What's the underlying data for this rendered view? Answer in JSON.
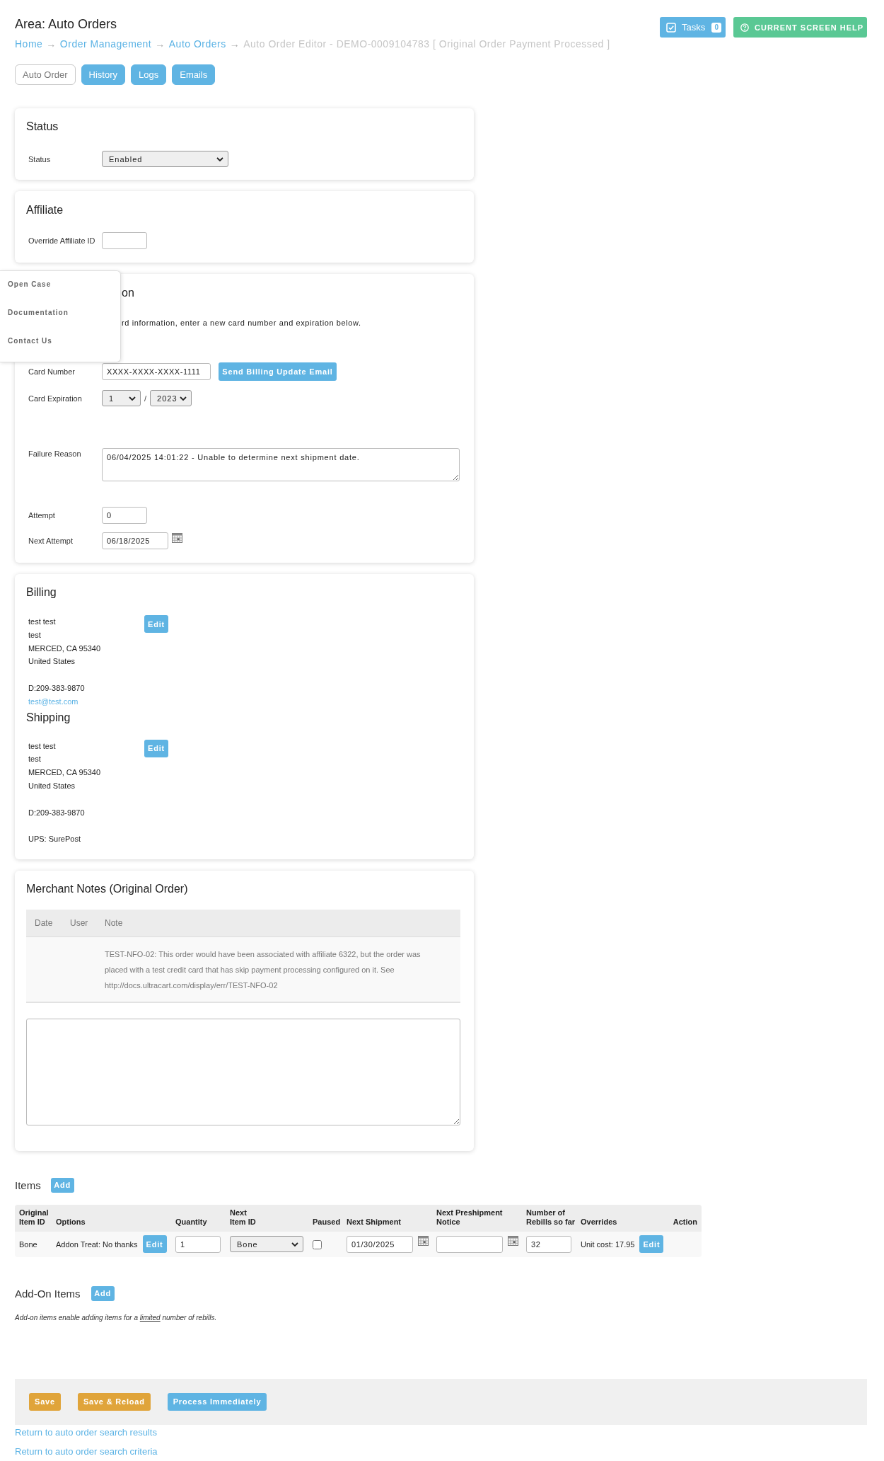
{
  "header": {
    "title": "Area: Auto Orders",
    "breadcrumb": [
      {
        "label": "Home",
        "current": false,
        "separator": "→"
      },
      {
        "label": "Order Management",
        "current": false,
        "separator": "→"
      },
      {
        "label": "Auto Orders",
        "current": false,
        "separator": "→"
      },
      {
        "label": "Auto Order Editor - DEMO-0009104783 [ Original Order Payment Processed ]",
        "current": true
      }
    ],
    "tasks": {
      "label": "Tasks",
      "count": "0"
    },
    "help_button": "CURRENT SCREEN HELP"
  },
  "tabs": [
    {
      "label": "Auto Order",
      "selected": true
    },
    {
      "label": "History",
      "selected": false
    },
    {
      "label": "Logs",
      "selected": false
    },
    {
      "label": "Emails",
      "selected": false
    }
  ],
  "help_menu": {
    "items": [
      "Open Case",
      "Documentation",
      "Contact Us"
    ]
  },
  "status": {
    "title": "Status",
    "label": "Status",
    "value": "Enabled"
  },
  "affiliate": {
    "title": "Affiliate",
    "label": "Override Affiliate ID"
  },
  "card_info": {
    "title": "on",
    "note": "rd information, enter a new card number and expiration below.",
    "card_number": {
      "label": "Card Number",
      "value": "XXXX-XXXX-XXXX-1111",
      "button": "Send Billing Update Email"
    },
    "expiration": {
      "label": "Card Expiration",
      "month": "1",
      "separator": "/",
      "year": "2023"
    },
    "failure_reason": {
      "label": "Failure Reason",
      "value": "06/04/2025 14:01:22 - Unable to determine next shipment date."
    },
    "attempt": {
      "label": "Attempt",
      "value": "0"
    },
    "next_attempt": {
      "label": "Next Attempt",
      "value": "06/18/2025"
    }
  },
  "billing": {
    "title": "Billing",
    "edit": "Edit",
    "address": [
      "test test",
      "test",
      "MERCED, CA 95340",
      "United States"
    ],
    "phone": "D:209-383-9870",
    "email": "test@test.com"
  },
  "shipping": {
    "title": "Shipping",
    "edit": "Edit",
    "address": [
      "test test",
      "test",
      "MERCED, CA 95340",
      "United States"
    ],
    "phone": "D:209-383-9870",
    "method": "UPS: SurePost"
  },
  "merchant_notes": {
    "title": "Merchant Notes (Original Order)",
    "columns": [
      "Date",
      "User",
      "Note"
    ],
    "rows": [
      {
        "note": "TEST-NFO-02: This order would have been associated with affiliate 6322, but the order was placed with a test credit card that has skip payment processing configured on it. See http://docs.ultracart.com/display/err/TEST-NFO-02"
      }
    ]
  },
  "items": {
    "title": "Items",
    "add": "Add",
    "columns": [
      "Original\nItem ID",
      "Options",
      "Quantity",
      "Next\nItem ID",
      "Paused",
      "Next Shipment",
      "Next Preshipment\nNotice",
      "Number of\nRebills so far",
      "Overrides",
      "Action"
    ],
    "rows": [
      {
        "original_item_id": "Bone",
        "options": "Addon Treat: No thanks",
        "options_edit": "Edit",
        "quantity": "1",
        "next_item_id": "Bone",
        "paused": false,
        "next_shipment": "01/30/2025",
        "rebills": "32",
        "overrides": "Unit cost: 17.95",
        "overrides_edit": "Edit"
      }
    ]
  },
  "addon_items": {
    "title": "Add-On Items",
    "add": "Add",
    "note_before": "Add-on items enable adding items for a",
    "note_link": "limited",
    "note_after": "number of rebills."
  },
  "actions": [
    {
      "label": "Save",
      "kind": "warning"
    },
    {
      "label": "Save & Reload",
      "kind": "warning"
    },
    {
      "label": "Process Immediately",
      "kind": "primary"
    }
  ],
  "links": [
    "Return to auto order search results",
    "Return to auto order search criteria"
  ]
}
